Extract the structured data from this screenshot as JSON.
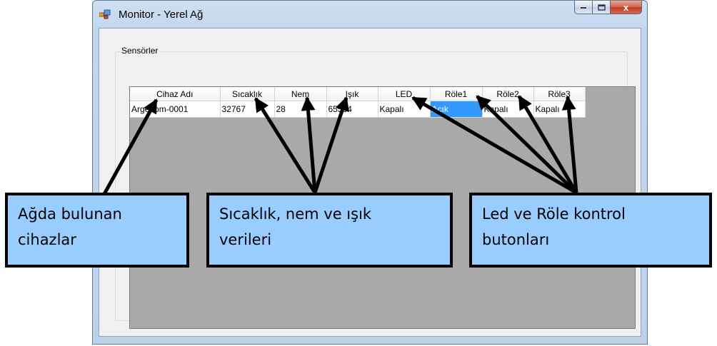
{
  "window": {
    "title": "Monitor - Yerel Ağ",
    "close_glyph": "x",
    "group_label": "Sensörler"
  },
  "grid": {
    "columns": [
      "Cihaz Adı",
      "Sıcaklık",
      "Nem",
      "Işık",
      "LED",
      "Röle1",
      "Röle2",
      "Röle3"
    ],
    "rows": [
      [
        "Argenom-0001",
        "32767",
        "28",
        "65534",
        "Kapalı",
        "Açık",
        "Kapalı",
        "Kapalı"
      ]
    ],
    "selected_cell": "Röle1"
  },
  "callouts": {
    "devices": [
      "Ağda bulunan",
      "cihazlar"
    ],
    "sensors": [
      "Sıcaklık, nem ve ışık",
      "verileri"
    ],
    "controls": [
      "Led ve Röle kontrol",
      "butonları"
    ]
  },
  "colors": {
    "callout_fill": "#99ccff",
    "grid_background": "#a9a9a9",
    "selection": "#3399ff"
  }
}
